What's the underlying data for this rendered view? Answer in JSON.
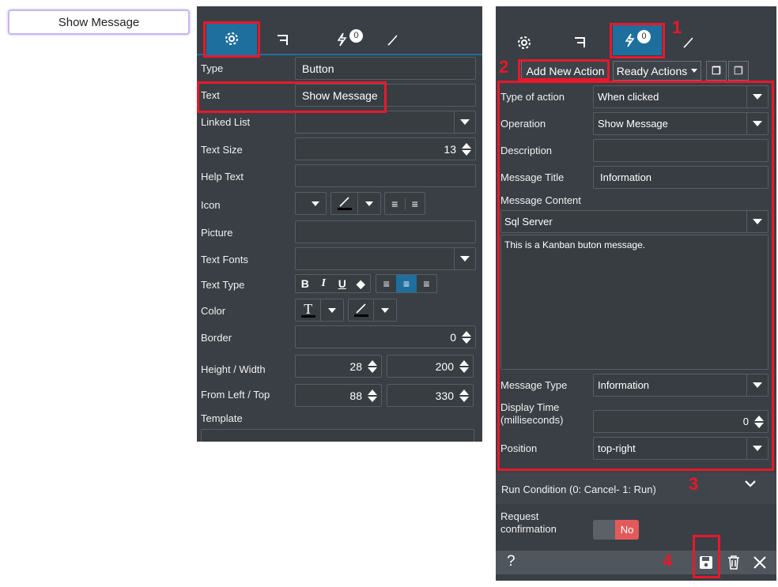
{
  "preview": {
    "button_text": "Show Message"
  },
  "left_panel": {
    "rows": [
      {
        "label": "Type",
        "value": "Button"
      },
      {
        "label": "Text",
        "value": "Show Message"
      },
      {
        "label": "Linked List",
        "value": ""
      },
      {
        "label": "Text Size",
        "value": "13"
      },
      {
        "label": "Help Text",
        "value": ""
      },
      {
        "label": "Icon"
      },
      {
        "label": "Picture",
        "value": ""
      },
      {
        "label": "Text Fonts",
        "value": ""
      },
      {
        "label": "Text Type"
      },
      {
        "label": "Color"
      },
      {
        "label": "Border",
        "value": "0"
      },
      {
        "label": "Height / Width",
        "value1": "28",
        "value2": "200"
      },
      {
        "label": "From Left / Top",
        "value1": "88",
        "value2": "330"
      },
      {
        "label": "Template"
      }
    ],
    "tab_badge": "0"
  },
  "right_panel": {
    "tab_badge": "0",
    "toolbar": {
      "add_action": "Add New Action",
      "ready_actions": "Ready Actions"
    },
    "rows": {
      "type_of_action": {
        "label": "Type of action",
        "value": "When clicked"
      },
      "operation": {
        "label": "Operation",
        "value": "Show Message"
      },
      "description": {
        "label": "Description",
        "value": ""
      },
      "message_title": {
        "label": "Message Title",
        "value": "Information"
      },
      "message_content": {
        "label": "Message Content",
        "source": "Sql Server",
        "text": "This is a Kanban buton message."
      },
      "message_type": {
        "label": "Message Type",
        "value": "Information"
      },
      "display_time": {
        "label1": "Display Time",
        "label2": "(milliseconds)",
        "value": "0"
      },
      "position": {
        "label": "Position",
        "value": "top-right"
      }
    },
    "run_condition": "Run Condition (0: Cancel- 1: Run)",
    "request_confirmation": {
      "label1": "Request",
      "label2": "confirmation",
      "toggle": "No"
    },
    "footer": {
      "help": "?"
    }
  },
  "annotations": {
    "n1": "1",
    "n2": "2",
    "n3": "3",
    "n4": "4"
  },
  "colors": {
    "panel": "#3a3f45",
    "active_tab": "#1e6f9e",
    "highlight": "#e8182c",
    "toggle_no": "#e35a5a"
  }
}
